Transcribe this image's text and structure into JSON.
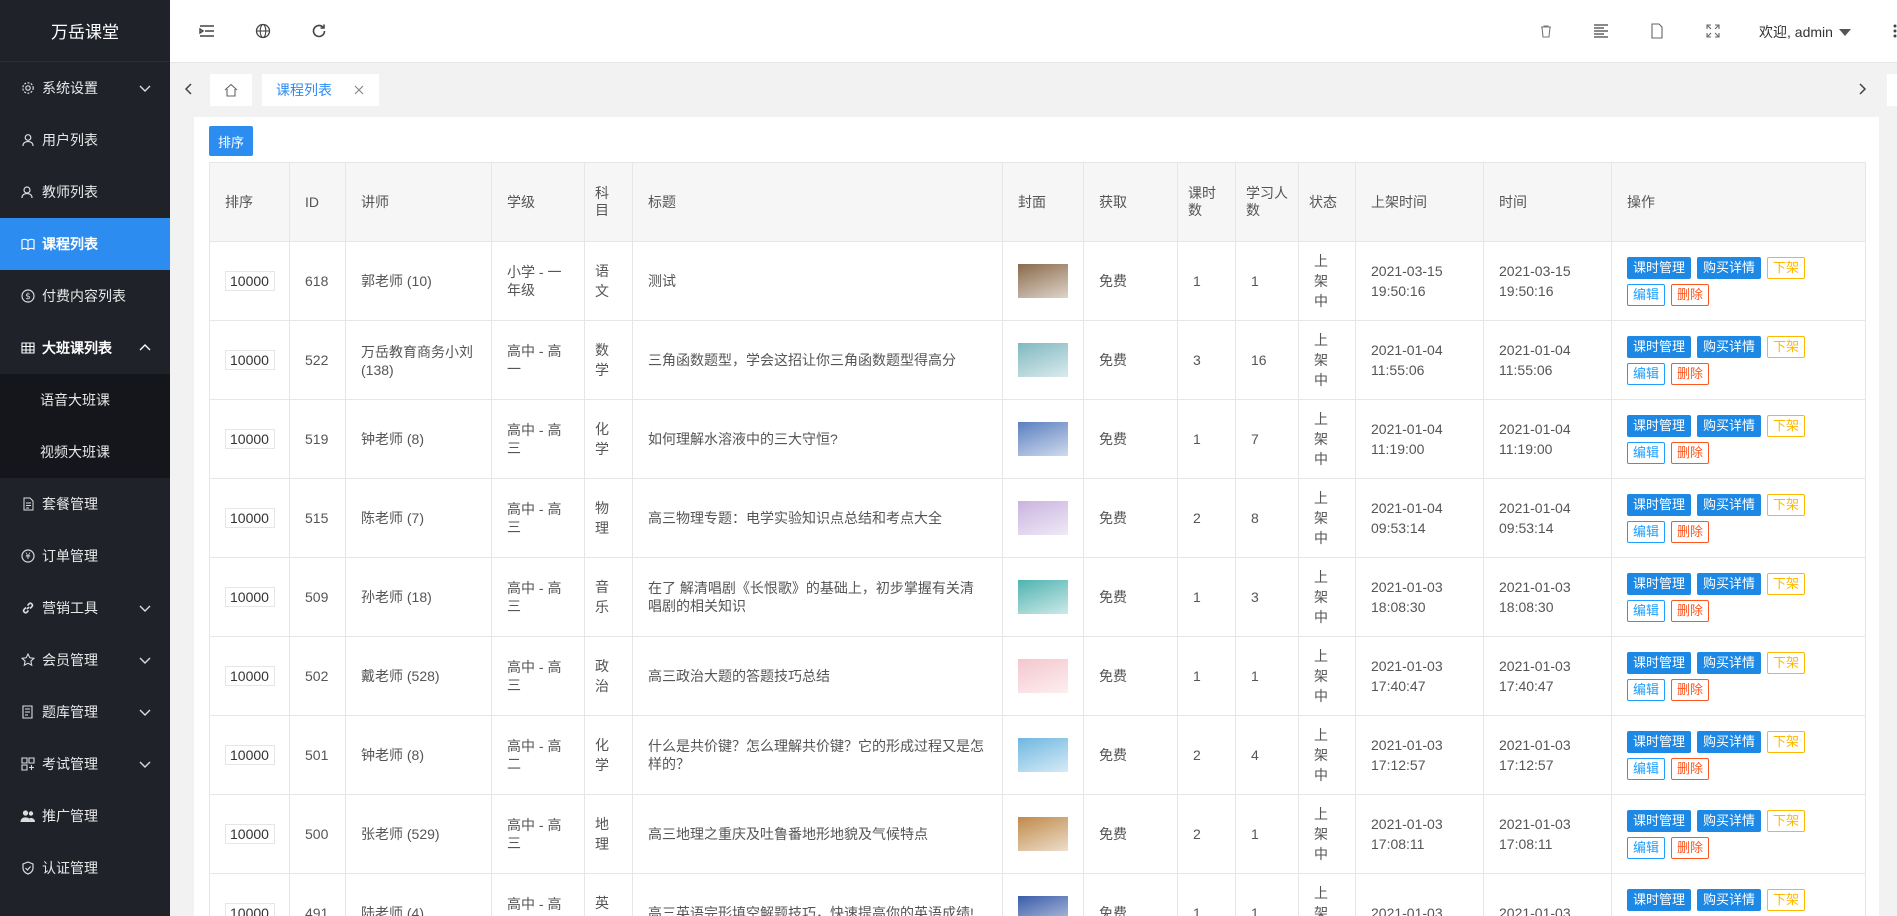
{
  "app": {
    "brand": "万岳课堂"
  },
  "sidebar": {
    "items": [
      {
        "label": "系统设置",
        "icon": "gear-icon",
        "chevron": true
      },
      {
        "label": "用户列表",
        "icon": "user-icon",
        "chevron": false
      },
      {
        "label": "教师列表",
        "icon": "teacher-icon",
        "chevron": false
      },
      {
        "label": "课程列表",
        "icon": "book-icon",
        "chevron": false,
        "active": true
      },
      {
        "label": "付费内容列表",
        "icon": "dollar-icon",
        "chevron": false
      },
      {
        "label": "大班课列表",
        "icon": "grid-icon",
        "chevron": true,
        "open": true
      },
      {
        "label": "套餐管理",
        "icon": "document-icon",
        "chevron": false
      },
      {
        "label": "订单管理",
        "icon": "yen-icon",
        "chevron": false
      },
      {
        "label": "营销工具",
        "icon": "link-icon",
        "chevron": true
      },
      {
        "label": "会员管理",
        "icon": "star-icon",
        "chevron": true
      },
      {
        "label": "题库管理",
        "icon": "question-bank-icon",
        "chevron": true
      },
      {
        "label": "考试管理",
        "icon": "exam-icon",
        "chevron": true
      },
      {
        "label": "推广管理",
        "icon": "users-icon",
        "chevron": false
      },
      {
        "label": "认证管理",
        "icon": "shield-icon",
        "chevron": false
      }
    ],
    "subitems": [
      "语音大班课",
      "视频大班课"
    ]
  },
  "header": {
    "welcome": "欢迎, admin"
  },
  "tabs": {
    "current": "课程列表"
  },
  "toolbar": {
    "sort_label": "排序"
  },
  "table": {
    "columns": [
      "排序",
      "ID",
      "讲师",
      "学级",
      "科目",
      "标题",
      "封面",
      "获取",
      "课时数",
      "学习人数",
      "状态",
      "上架时间",
      "时间",
      "操作"
    ],
    "rows": [
      {
        "sort": "10000",
        "id": "618",
        "teacher": "郭老师 (10)",
        "grade": "小学 - 一年级",
        "subject": "语文",
        "title": "测试",
        "cover": "#8a6a4a",
        "access": "免费",
        "lessons": "1",
        "learners": "1",
        "status": "上架中",
        "listed": "2021-03-15 19:50:16",
        "time": "2021-03-15 19:50:16"
      },
      {
        "sort": "10000",
        "id": "522",
        "teacher": "万岳教育商务小刘 (138)",
        "grade": "高中 - 高一",
        "subject": "数学",
        "title": "三角函数题型，学会这招让你三角函数题型得高分",
        "cover": "#7fb8c0",
        "access": "免费",
        "lessons": "3",
        "learners": "16",
        "status": "上架中",
        "listed": "2021-01-04 11:55:06",
        "time": "2021-01-04 11:55:06"
      },
      {
        "sort": "10000",
        "id": "519",
        "teacher": "钟老师 (8)",
        "grade": "高中 - 高三",
        "subject": "化学",
        "title": "如何理解水溶液中的三大守恒?",
        "cover": "#5a7fc0",
        "access": "免费",
        "lessons": "1",
        "learners": "7",
        "status": "上架中",
        "listed": "2021-01-04 11:19:00",
        "time": "2021-01-04 11:19:00"
      },
      {
        "sort": "10000",
        "id": "515",
        "teacher": "陈老师 (7)",
        "grade": "高中 - 高三",
        "subject": "物理",
        "title": "高三物理专题：电学实验知识点总结和考点大全",
        "cover": "#c9b3e0",
        "access": "免费",
        "lessons": "2",
        "learners": "8",
        "status": "上架中",
        "listed": "2021-01-04 09:53:14",
        "time": "2021-01-04 09:53:14"
      },
      {
        "sort": "10000",
        "id": "509",
        "teacher": "孙老师 (18)",
        "grade": "高中 - 高三",
        "subject": "音乐",
        "title": "在了 解清唱剧《长恨歌》的基础上，初步掌握有关清唱剧的相关知识",
        "cover": "#4fb3b0",
        "access": "免费",
        "lessons": "1",
        "learners": "3",
        "status": "上架中",
        "listed": "2021-01-03 18:08:30",
        "time": "2021-01-03 18:08:30"
      },
      {
        "sort": "10000",
        "id": "502",
        "teacher": "戴老师 (528)",
        "grade": "高中 - 高三",
        "subject": "政治",
        "title": "高三政治大题的答题技巧总结",
        "cover": "#f4c6cc",
        "access": "免费",
        "lessons": "1",
        "learners": "1",
        "status": "上架中",
        "listed": "2021-01-03 17:40:47",
        "time": "2021-01-03 17:40:47"
      },
      {
        "sort": "10000",
        "id": "501",
        "teacher": "钟老师 (8)",
        "grade": "高中 - 高二",
        "subject": "化学",
        "title": "什么是共价键？怎么理解共价键？它的形成过程又是怎样的？",
        "cover": "#6fb7e0",
        "access": "免费",
        "lessons": "2",
        "learners": "4",
        "status": "上架中",
        "listed": "2021-01-03 17:12:57",
        "time": "2021-01-03 17:12:57"
      },
      {
        "sort": "10000",
        "id": "500",
        "teacher": "张老师 (529)",
        "grade": "高中 - 高三",
        "subject": "地理",
        "title": "高三地理之重庆及吐鲁番地形地貌及气候特点",
        "cover": "#c08a4a",
        "access": "免费",
        "lessons": "2",
        "learners": "1",
        "status": "上架中",
        "listed": "2021-01-03 17:08:11",
        "time": "2021-01-03 17:08:11"
      },
      {
        "sort": "10000",
        "id": "491",
        "teacher": "陆老师 (4)",
        "grade": "高中 - 高三",
        "subject": "英语",
        "title": "高三英语完形填空解题技巧，快速提高你的英语成绩!",
        "cover": "#3a5ca8",
        "access": "免费",
        "lessons": "1",
        "learners": "1",
        "status": "上架中",
        "listed": "2021-01-03",
        "time": "2021-01-03"
      }
    ],
    "actions": {
      "lesson_mgmt": "课时管理",
      "purchase": "购买详情",
      "offline": "下架",
      "edit": "编辑",
      "delete": "删除"
    }
  },
  "colors": {
    "sidebar_bg": "#20222a",
    "accent": "#2d8cf0",
    "warn": "#ffb800",
    "danger": "#ff5722"
  }
}
